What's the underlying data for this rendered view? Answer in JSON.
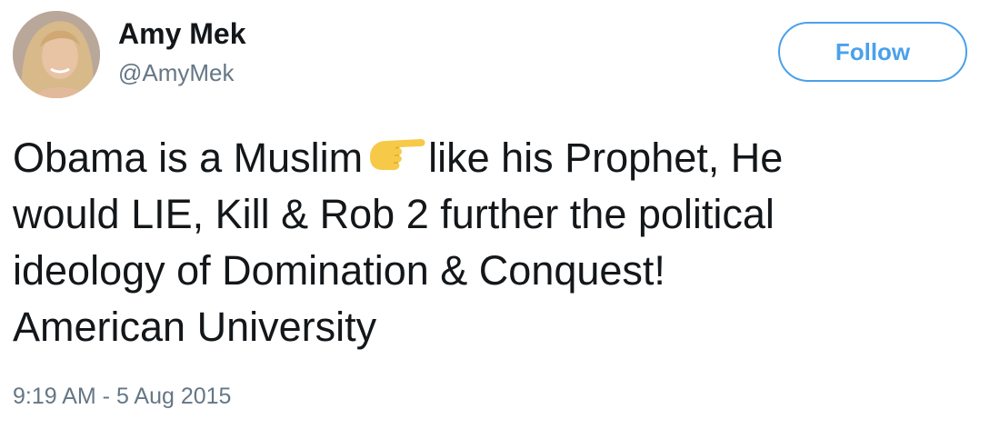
{
  "author": {
    "display_name": "Amy Mek",
    "handle": "@AmyMek"
  },
  "follow_button": {
    "label": "Follow"
  },
  "tweet": {
    "lines": [
      {
        "before_emoji": "Obama is a Muslim",
        "emoji": "backhand-index-pointing-right",
        "after_emoji": "like his Prophet, He"
      },
      {
        "text": "would LIE, Kill & Rob 2 further the political"
      },
      {
        "text": "ideology of Domination & Conquest!"
      },
      {
        "text": "American University"
      }
    ],
    "timestamp": "9:19 AM - 5 Aug 2015"
  },
  "colors": {
    "text": "#14171a",
    "secondary": "#657786",
    "accent": "#4aa1eb",
    "emoji": "#f7c948"
  },
  "icons": {
    "avatar": "user-avatar-photo",
    "emoji": "pointing-right-hand-icon"
  }
}
